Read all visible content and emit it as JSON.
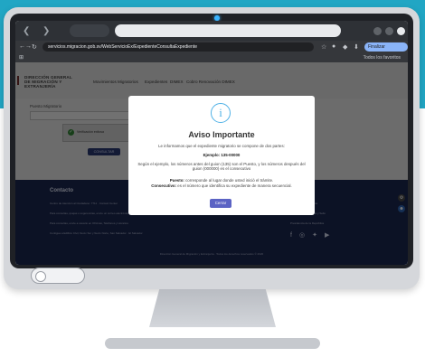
{
  "browser": {
    "url": "servicios.migracion.gob.sv/WebServicioEx/ExpedienteConsultaExpediente",
    "update_button": "Finalizar actualización",
    "bookmarks_label": "Todos los favoritos"
  },
  "site": {
    "logo_lines": [
      "DIRECCIÓN GENERAL",
      "DE MIGRACIÓN Y",
      "EXTRANJERÍA"
    ],
    "menu": [
      "Movimientos Migratorios",
      "Expedientes",
      "DIMEX",
      "Cobro Renovación DIMEX"
    ],
    "field_label": "Puesto Migratorio",
    "captcha_text": "Verificación exitosa",
    "consultar_label": "CONSULTAR"
  },
  "footer": {
    "title": "Contacto",
    "left_lines": [
      "Centro de Atención al Ciudadano: 7711 · Contact Center",
      "Para consultas, quejas o sugerencias, envíe un correo electrónico",
      "Para consultas, envíe a usuario en Oficinas, Teléfonos y Horarios",
      "Contigua a Edificio Civil, 9a Av Sur y 9a Av Norte, San Salvador · El Salvador"
    ],
    "right_lines": [
      "Gobernación y Política",
      "Relaciones Exteriores y Sello",
      "Presidencia de la República"
    ],
    "social": [
      "f",
      "◎",
      "✦",
      "▶"
    ],
    "copyright": "Dirección General de Migración y Extranjería · Todos los derechos reservados © 2020"
  },
  "modal": {
    "icon": "i",
    "title": "Aviso Importante",
    "intro": "Le informamos que el expediente migratorio se compone de dos partes:",
    "example_label": "Ejemplo: 135-00000",
    "explanation": "Según el ejemplo, los números antes del guion (135) son el Puesto, y los números después del guion (000000) es el consecutivo",
    "puesto_label": "Puesto:",
    "puesto_text": "corresponde al lugar donde usted inició el trámite.",
    "consecutivo_label": "Consecutivo:",
    "consecutivo_text": "es el número que identifica su expediente de manera secuencial.",
    "close_button": "Cerrar"
  },
  "colors": {
    "background": "#21a6c4",
    "footer": "#19244a",
    "modal_button": "#5b63c4",
    "info_icon": "#4fb1e6"
  }
}
